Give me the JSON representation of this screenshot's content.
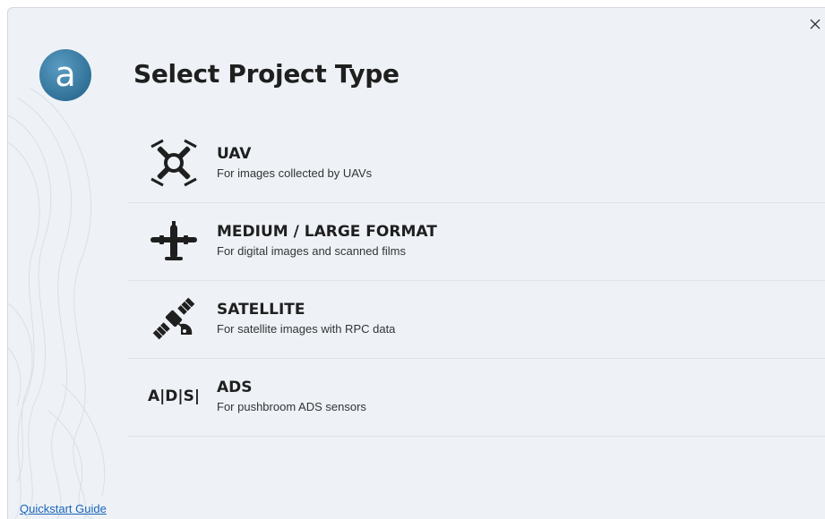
{
  "dialog": {
    "title": "Select Project Type",
    "logo_letter": "a",
    "close_icon": "close-icon",
    "accent_color": "#3a7fa6"
  },
  "options": [
    {
      "label": "UAV",
      "description": "For images collected by UAVs",
      "icon": "drone-icon"
    },
    {
      "label": "MEDIUM / LARGE FORMAT",
      "description": "For digital images and scanned films",
      "icon": "airplane-icon"
    },
    {
      "label": "SATELLITE",
      "description": "For satellite images with RPC data",
      "icon": "satellite-icon"
    },
    {
      "label": "ADS",
      "description": "For pushbroom ADS sensors",
      "icon": "ads-icon",
      "icon_text": "A|D|S|"
    }
  ],
  "footer": {
    "quickstart_label": "Quickstart Guide"
  }
}
